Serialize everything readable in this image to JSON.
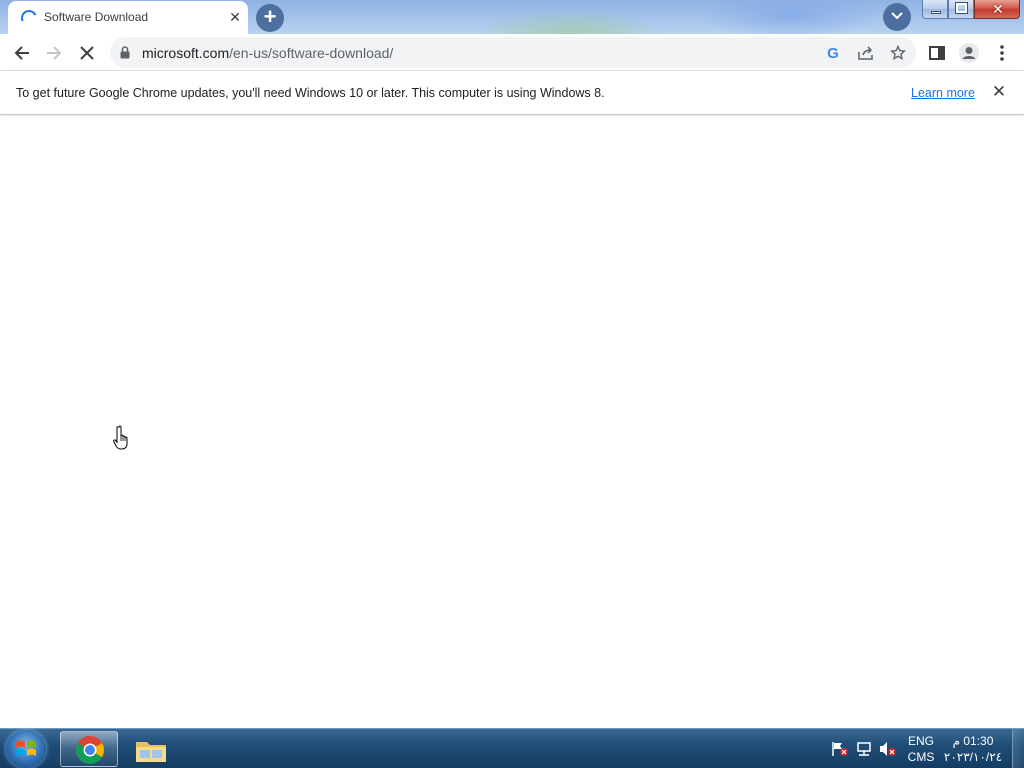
{
  "browser": {
    "tab": {
      "title": "Software Download",
      "close_glyph": "✕",
      "loading": true,
      "icon": "loading-spinner-icon"
    },
    "new_tab_glyph": "+",
    "toolbar": {
      "url_host": "microsoft.com",
      "url_path": "/en-us/software-download/",
      "icons": [
        "back-arrow-icon",
        "forward-arrow-icon",
        "stop-loading-icon",
        "lock-icon",
        "google-lens-icon",
        "share-icon",
        "bookmark-star-icon",
        "side-panel-icon",
        "profile-icon",
        "menu-dots-icon"
      ],
      "google_glyph": "G"
    },
    "infobar": {
      "message": "To get future Google Chrome updates, you'll need Windows 10 or later. This computer is using Windows 8.",
      "link": "Learn more",
      "close_glyph": "✕"
    },
    "window_controls": {
      "close_glyph": "✕"
    }
  },
  "taskbar": {
    "apps": [
      "chrome-icon",
      "file-explorer-icon"
    ],
    "tray": {
      "language": "ENG",
      "input_method": "CMS",
      "time": "01:30 م",
      "date": "٢٠٢٣/١٠/٢٤",
      "icons": [
        "action-center-flag-icon",
        "network-icon",
        "volume-muted-icon"
      ]
    }
  },
  "colors": {
    "tabstrip": "#a8c5ec",
    "accent_blue": "#1a73e8",
    "taskbar": "#1f4e78",
    "close_red": "#c23a2b"
  }
}
